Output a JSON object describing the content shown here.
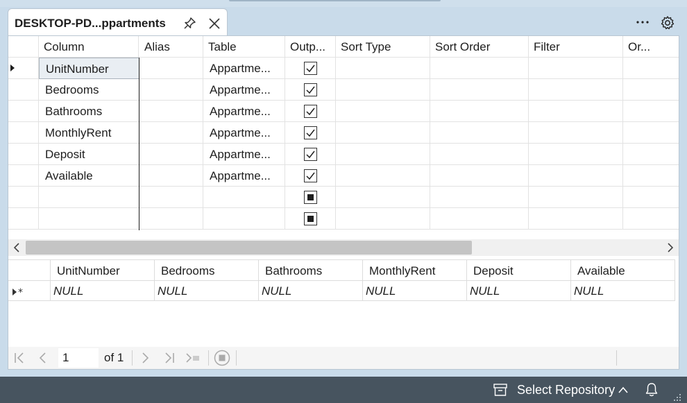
{
  "tab": {
    "title": "DESKTOP-PD...ppartments"
  },
  "criteria": {
    "headers": [
      "Column",
      "Alias",
      "Table",
      "Outp...",
      "Sort Type",
      "Sort Order",
      "Filter",
      "Or..."
    ],
    "rows": [
      {
        "column": "UnitNumber",
        "alias": "",
        "table": "Appartme...",
        "output": true
      },
      {
        "column": "Bedrooms",
        "alias": "",
        "table": "Appartme...",
        "output": true
      },
      {
        "column": "Bathrooms",
        "alias": "",
        "table": "Appartme...",
        "output": true
      },
      {
        "column": "MonthlyRent",
        "alias": "",
        "table": "Appartme...",
        "output": true
      },
      {
        "column": "Deposit",
        "alias": "",
        "table": "Appartme...",
        "output": true
      },
      {
        "column": "Available",
        "alias": "",
        "table": "Appartme...",
        "output": true
      }
    ]
  },
  "results": {
    "headers": [
      "UnitNumber",
      "Bedrooms",
      "Bathrooms",
      "MonthlyRent",
      "Deposit",
      "Available"
    ],
    "row": [
      "NULL",
      "NULL",
      "NULL",
      "NULL",
      "NULL",
      "NULL"
    ]
  },
  "navigator": {
    "page": "1",
    "of_label": "of 1"
  },
  "status": {
    "repo_label": "Select Repository"
  }
}
